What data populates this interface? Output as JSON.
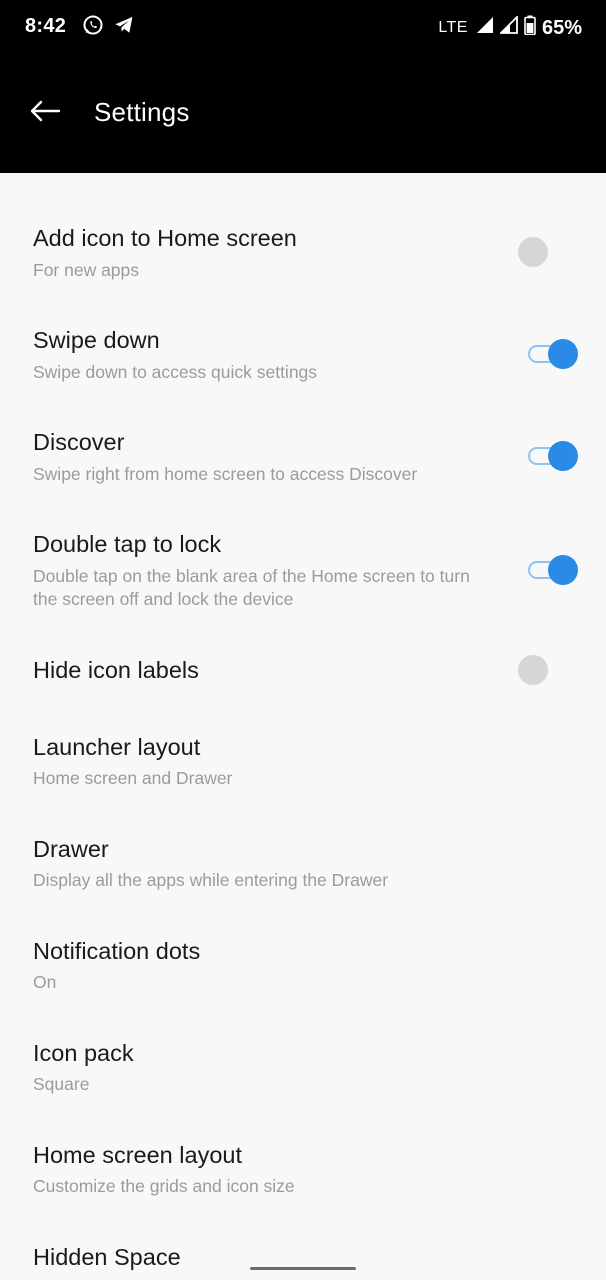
{
  "status_bar": {
    "time": "8:42",
    "left_icons": [
      "whatsapp-icon",
      "telegram-icon"
    ],
    "network": "LTE",
    "battery_percent": "65%"
  },
  "app_bar": {
    "title": "Settings"
  },
  "settings": [
    {
      "title": "Add icon to Home screen",
      "subtitle": "For new apps",
      "toggle": false
    },
    {
      "title": "Swipe down",
      "subtitle": "Swipe down to access quick settings",
      "toggle": true
    },
    {
      "title": "Discover",
      "subtitle": "Swipe right from home screen to access Discover",
      "toggle": true
    },
    {
      "title": "Double tap to lock",
      "subtitle": "Double tap on the blank area of the Home screen to turn the screen off and lock the device",
      "toggle": true
    },
    {
      "title": "Hide icon labels",
      "subtitle": "",
      "toggle": false
    },
    {
      "title": "Launcher layout",
      "subtitle": "Home screen and Drawer"
    },
    {
      "title": "Drawer",
      "subtitle": "Display all the apps while entering the Drawer"
    },
    {
      "title": "Notification dots",
      "subtitle": "On"
    },
    {
      "title": "Icon pack",
      "subtitle": "Square"
    },
    {
      "title": "Home screen layout",
      "subtitle": "Customize the grids and icon size"
    },
    {
      "title": "Hidden Space",
      "subtitle": ""
    }
  ],
  "colors": {
    "accent": "#2a8ae6",
    "accent_track": "#8ec3f1",
    "toggle_off": "#d6d6d6",
    "background": "#f8f8f8",
    "header": "#000000"
  }
}
